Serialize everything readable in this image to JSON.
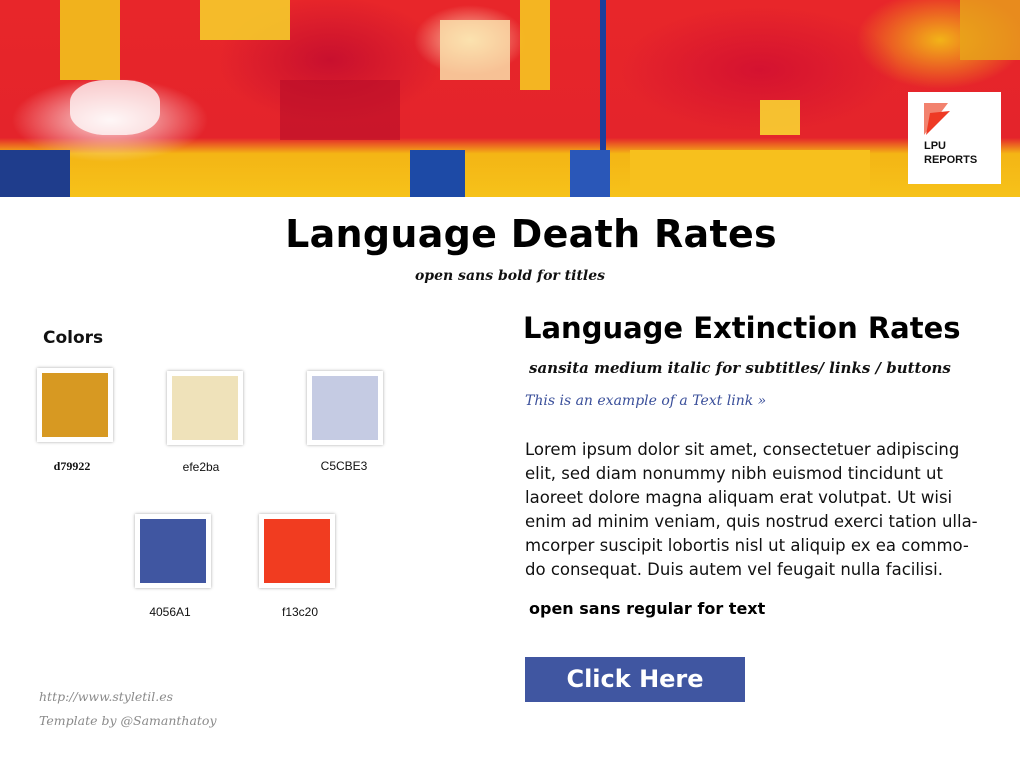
{
  "header": {
    "logo_text": [
      "LPU",
      "REPORTS"
    ]
  },
  "title": {
    "text": "Language Death Rates",
    "caption": "open sans bold for titles"
  },
  "colors": {
    "heading": "Colors",
    "swatches": [
      {
        "hex": "#d79922",
        "label": "d79922"
      },
      {
        "hex": "#efe2ba",
        "label": "efe2ba"
      },
      {
        "hex": "#c5cbe3",
        "label": "C5CBE3"
      },
      {
        "hex": "#4056a1",
        "label": "4056A1"
      },
      {
        "hex": "#f13c20",
        "label": "f13c20"
      }
    ]
  },
  "subtitle": {
    "text": "Language Extinction Rates",
    "caption": "sansita medium italic for subtitles/ links / buttons"
  },
  "link": {
    "text": "This is an example of a Text link »",
    "color": "#3a4f9a"
  },
  "body_text": {
    "lines": [
      "Lorem ipsum dolor sit amet, consectetuer adipiscing",
      "elit, sed diam nonummy nibh euismod tincidunt ut",
      "laoreet dolore magna aliquam erat volutpat. Ut wisi",
      "enim ad minim veniam, quis nostrud exerci tation ulla-",
      "mcorper suscipit lobortis nisl ut aliquip ex ea commo-",
      "do consequat. Duis autem vel feugait nulla facilisi."
    ],
    "caption": "open sans regular for text"
  },
  "button": {
    "label": "Click Here",
    "color": "#4056a1"
  },
  "footer": {
    "url": "http://www.styletil.es",
    "credit": "Template by @Samanthatoy"
  },
  "icons": {
    "banner": "abstract-painting-banner",
    "logo": "lpu-reports-logo-icon"
  }
}
